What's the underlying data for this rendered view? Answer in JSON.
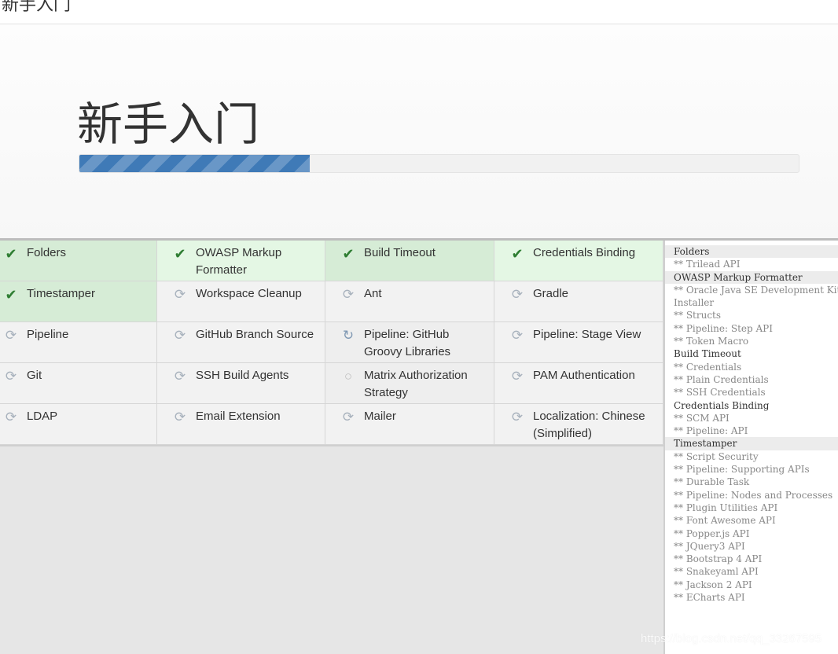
{
  "topbar": {
    "title": "新手入门"
  },
  "header": {
    "title": "新手入门",
    "progress_fraction": 0.32
  },
  "plugins": [
    {
      "label": "Folders",
      "status": "installed",
      "icon": "check-icon"
    },
    {
      "label": "OWASP Markup Formatter",
      "status": "installed-light",
      "icon": "check-icon"
    },
    {
      "label": "Build Timeout",
      "status": "installed",
      "icon": "check-icon"
    },
    {
      "label": "Credentials Binding",
      "status": "installed-light",
      "icon": "check-icon"
    },
    {
      "label": "Timestamper",
      "status": "installed",
      "icon": "check-icon"
    },
    {
      "label": "Workspace Cleanup",
      "status": "pending",
      "icon": "refresh-icon"
    },
    {
      "label": "Ant",
      "status": "pending",
      "icon": "refresh-icon"
    },
    {
      "label": "Gradle",
      "status": "pending",
      "icon": "refresh-icon"
    },
    {
      "label": "Pipeline",
      "status": "pending",
      "icon": "refresh-icon"
    },
    {
      "label": "GitHub Branch Source",
      "status": "pending",
      "icon": "refresh-icon"
    },
    {
      "label": "Pipeline: GitHub Groovy Libraries",
      "status": "installing",
      "icon": "spinner-icon"
    },
    {
      "label": "Pipeline: Stage View",
      "status": "pending",
      "icon": "refresh-icon"
    },
    {
      "label": "Git",
      "status": "pending",
      "icon": "refresh-icon"
    },
    {
      "label": "SSH Build Agents",
      "status": "pending",
      "icon": "refresh-icon"
    },
    {
      "label": "Matrix Authorization Strategy",
      "status": "queued",
      "icon": "circle-icon"
    },
    {
      "label": "PAM Authentication",
      "status": "pending",
      "icon": "refresh-icon"
    },
    {
      "label": "LDAP",
      "status": "pending",
      "icon": "refresh-icon"
    },
    {
      "label": "Email Extension",
      "status": "pending",
      "icon": "refresh-icon"
    },
    {
      "label": "Mailer",
      "status": "pending",
      "icon": "refresh-icon"
    },
    {
      "label": "Localization: Chinese (Simplified)",
      "status": "pending",
      "icon": "refresh-icon"
    }
  ],
  "log": [
    {
      "text": "Folders",
      "kind": "head",
      "shade": true
    },
    {
      "text": "** Trilead API",
      "kind": "dep"
    },
    {
      "text": "OWASP Markup Formatter",
      "kind": "head",
      "shade": true
    },
    {
      "text": "** Oracle Java SE Development Kit",
      "kind": "dep"
    },
    {
      "text": "Installer",
      "kind": "dep"
    },
    {
      "text": "** Structs",
      "kind": "dep"
    },
    {
      "text": "** Pipeline: Step API",
      "kind": "dep"
    },
    {
      "text": "** Token Macro",
      "kind": "dep"
    },
    {
      "text": "Build Timeout",
      "kind": "head",
      "shade": false
    },
    {
      "text": "** Credentials",
      "kind": "dep"
    },
    {
      "text": "** Plain Credentials",
      "kind": "dep"
    },
    {
      "text": "** SSH Credentials",
      "kind": "dep"
    },
    {
      "text": "Credentials Binding",
      "kind": "head",
      "shade": false
    },
    {
      "text": "** SCM API",
      "kind": "dep"
    },
    {
      "text": "** Pipeline: API",
      "kind": "dep"
    },
    {
      "text": "Timestamper",
      "kind": "head",
      "shade": true
    },
    {
      "text": "** Script Security",
      "kind": "dep"
    },
    {
      "text": "** Pipeline: Supporting APIs",
      "kind": "dep"
    },
    {
      "text": "** Durable Task",
      "kind": "dep"
    },
    {
      "text": "** Pipeline: Nodes and Processes",
      "kind": "dep"
    },
    {
      "text": "** Plugin Utilities API",
      "kind": "dep"
    },
    {
      "text": "** Font Awesome API",
      "kind": "dep"
    },
    {
      "text": "** Popper.js API",
      "kind": "dep"
    },
    {
      "text": "** JQuery3 API",
      "kind": "dep"
    },
    {
      "text": "** Bootstrap 4 API",
      "kind": "dep"
    },
    {
      "text": "** Snakeyaml API",
      "kind": "dep"
    },
    {
      "text": "** Jackson 2 API",
      "kind": "dep"
    },
    {
      "text": "** ECharts API",
      "kind": "dep"
    }
  ],
  "watermark": "https://blog.csdn.net/qq_33267595",
  "colors": {
    "progress": "#3f7ab7",
    "installed_bg": "#d6ecd6",
    "check": "#2e7d32",
    "pending_icon": "#a8b2bd"
  }
}
